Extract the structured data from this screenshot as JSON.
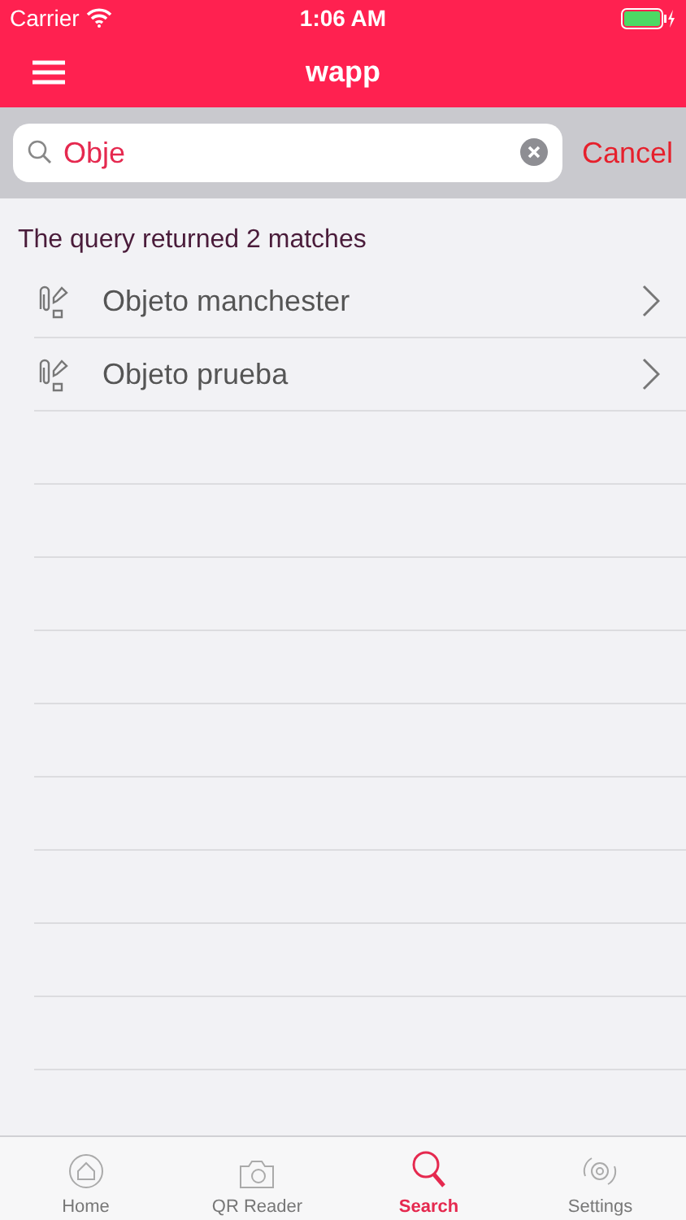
{
  "status_bar": {
    "carrier": "Carrier",
    "time": "1:06 AM"
  },
  "nav_bar": {
    "title": "wapp"
  },
  "search": {
    "value": "Obje",
    "cancel": "Cancel"
  },
  "summary": "The query returned 2 matches",
  "results": [
    {
      "label": "Objeto manchester"
    },
    {
      "label": "Objeto prueba"
    }
  ],
  "tab_bar": [
    {
      "label": "Home",
      "kind": "home",
      "selected": false
    },
    {
      "label": "QR Reader",
      "kind": "camera",
      "selected": false
    },
    {
      "label": "Search",
      "kind": "search",
      "selected": true
    },
    {
      "label": "Settings",
      "kind": "settings",
      "selected": false
    }
  ]
}
